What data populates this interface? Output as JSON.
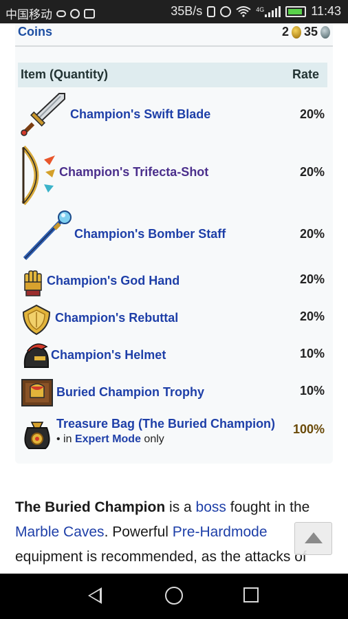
{
  "status_bar": {
    "carrier": "中国移动",
    "speed": "35B/s",
    "network": "4G",
    "time": "11:43"
  },
  "coins": {
    "label": "Coins",
    "gold": "2",
    "platinum": "35"
  },
  "table": {
    "header_item": "Item (Quantity)",
    "header_rate": "Rate",
    "rows": [
      {
        "name": "Champion's Swift Blade",
        "rate": "20%",
        "icon": "sword-icon"
      },
      {
        "name": "Champion's Trifecta-Shot",
        "rate": "20%",
        "icon": "bow-icon"
      },
      {
        "name": "Champion's Bomber Staff",
        "rate": "20%",
        "icon": "staff-icon"
      },
      {
        "name": "Champion's God Hand",
        "rate": "20%",
        "icon": "gauntlet-icon"
      },
      {
        "name": "Champion's Rebuttal",
        "rate": "20%",
        "icon": "shield-icon"
      },
      {
        "name": "Champion's Helmet",
        "rate": "10%",
        "icon": "helmet-icon"
      },
      {
        "name": "Buried Champion Trophy",
        "rate": "10%",
        "icon": "trophy-icon"
      },
      {
        "name": "Treasure Bag (The Buried Champion)",
        "rate": "100%",
        "icon": "treasure-bag-icon",
        "note_prefix": "• in",
        "note_link": "Expert Mode",
        "note_suffix": "only"
      }
    ]
  },
  "paragraph": {
    "t1": "The Buried Champion",
    "t2": " is a ",
    "t3": "boss",
    "t4": " fought in the ",
    "t5": "Marble Caves",
    "t6": ". Powerful ",
    "t7": "Pre-Hardmode",
    "t8": " equipment is recommended, as the attacks of"
  },
  "colors": {
    "link": "#1e3fa8",
    "visited_link": "#4b2f8c",
    "table_header_bg": "#dfecef",
    "expert_rate": "#6a4a08"
  }
}
